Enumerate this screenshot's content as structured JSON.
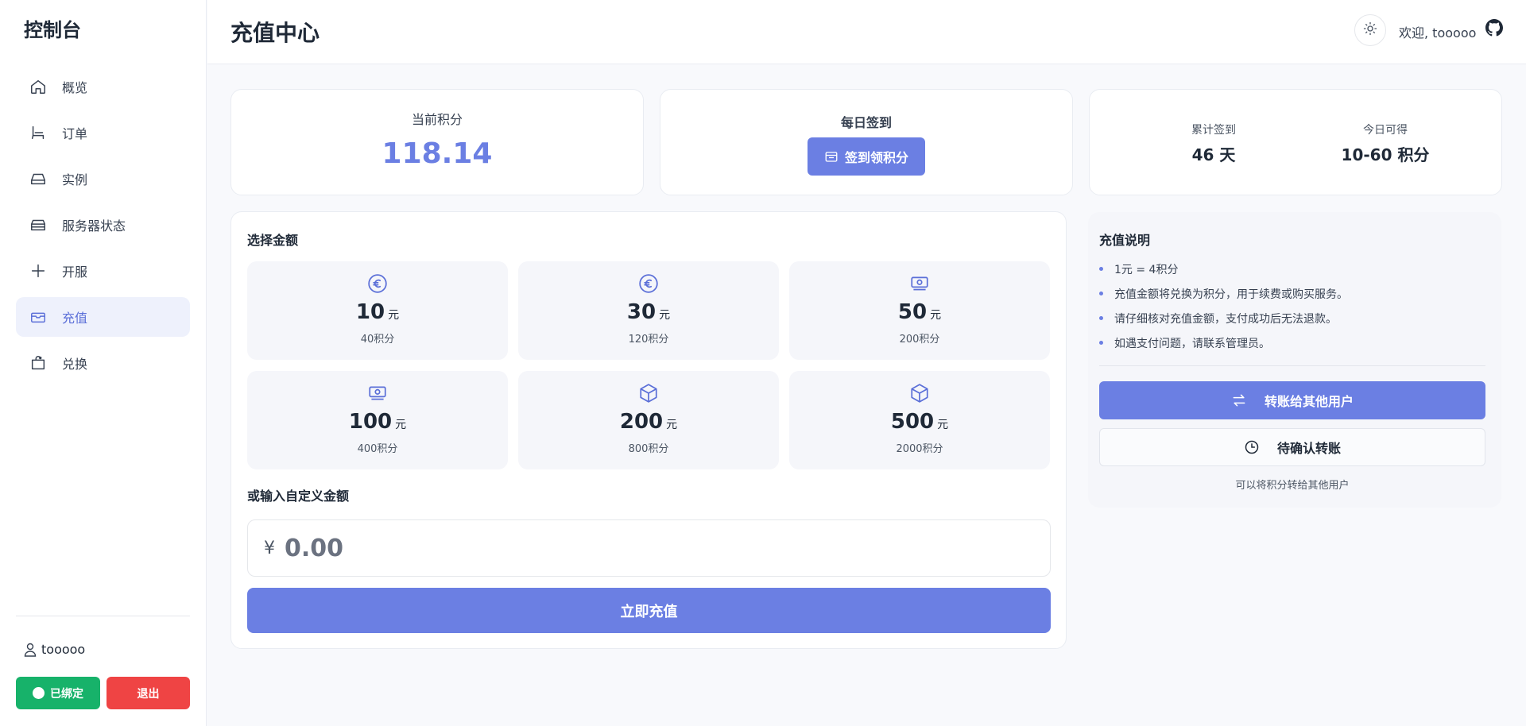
{
  "sidebar": {
    "brand": "控制台",
    "items": [
      {
        "label": "概览",
        "icon": "home-icon"
      },
      {
        "label": "订单",
        "icon": "chair-icon"
      },
      {
        "label": "实例",
        "icon": "drive-icon"
      },
      {
        "label": "服务器状态",
        "icon": "server-icon"
      },
      {
        "label": "开服",
        "icon": "plus-icon"
      },
      {
        "label": "充值",
        "icon": "recharge-icon",
        "active": true
      },
      {
        "label": "兑换",
        "icon": "bag-icon"
      }
    ],
    "username": "tooooo",
    "bound_label": "已绑定",
    "logout_label": "退出"
  },
  "header": {
    "title": "充值中心",
    "welcome": "欢迎, tooooo"
  },
  "stats": {
    "points_label": "当前积分",
    "points_value": "118.14",
    "checkin_label": "每日签到",
    "checkin_button": "签到领积分",
    "total_checkin_label": "累计签到",
    "total_checkin_value": "46 天",
    "today_label": "今日可得",
    "today_value": "10-60 积分"
  },
  "recharge": {
    "select_title": "选择金额",
    "unit": "元",
    "amounts": [
      {
        "value": "10",
        "points": "40积分",
        "icon": "euro-coin-icon"
      },
      {
        "value": "30",
        "points": "120积分",
        "icon": "euro-coin-icon"
      },
      {
        "value": "50",
        "points": "200积分",
        "icon": "banknote-icon"
      },
      {
        "value": "100",
        "points": "400积分",
        "icon": "banknote-icon"
      },
      {
        "value": "200",
        "points": "800积分",
        "icon": "box-icon"
      },
      {
        "value": "500",
        "points": "2000积分",
        "icon": "box-icon"
      }
    ],
    "custom_title": "或输入自定义金额",
    "currency": "¥",
    "custom_placeholder": "0.00",
    "submit_label": "立即充值"
  },
  "info": {
    "title": "充值说明",
    "notes": [
      "1元 = 4积分",
      "充值金额将兑换为积分，用于续费或购买服务。",
      "请仔细核对充值金额，支付成功后无法退款。",
      "如遇支付问题，请联系管理员。"
    ],
    "transfer_button": "转账给其他用户",
    "pending_button": "待确认转账",
    "footer_note": "可以将积分转给其他用户"
  },
  "colors": {
    "accent": "#6b7fe3",
    "success": "#17b26a",
    "danger": "#ef4444"
  }
}
